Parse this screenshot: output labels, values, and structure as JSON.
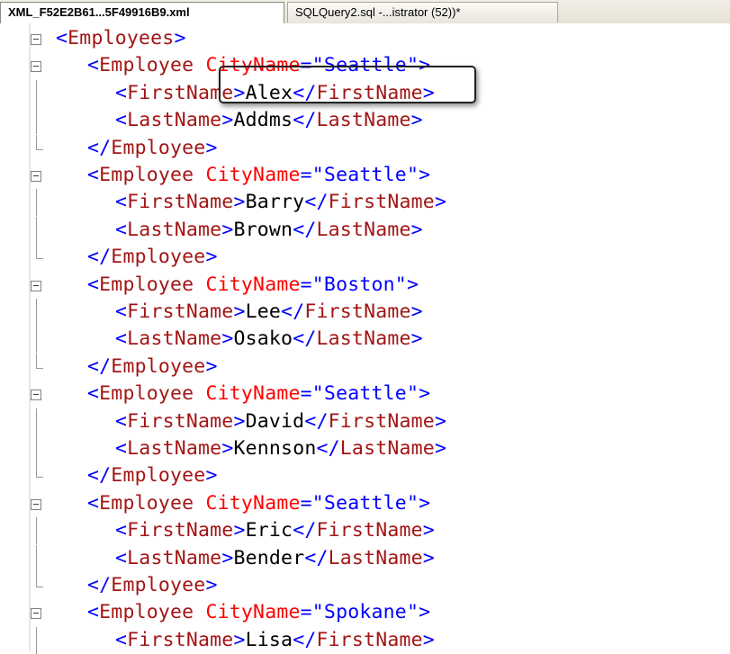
{
  "tabs": [
    {
      "label": "XML_F52E2B61...5F49916B9.xml",
      "active": true
    },
    {
      "label": "SQLQuery2.sql -...istrator (52))*",
      "active": false
    }
  ],
  "xml": {
    "root_tag": "Employees",
    "element_tag": "Employee",
    "attr_name": "CityName",
    "first_tag": "FirstName",
    "last_tag": "LastName",
    "employees": [
      {
        "city": "Seattle",
        "first": "Alex",
        "last": "Addms"
      },
      {
        "city": "Seattle",
        "first": "Barry",
        "last": "Brown"
      },
      {
        "city": "Boston",
        "first": "Lee",
        "last": "Osako"
      },
      {
        "city": "Seattle",
        "first": "David",
        "last": "Kennson"
      },
      {
        "city": "Seattle",
        "first": "Eric",
        "last": "Bender"
      },
      {
        "city": "Spokane",
        "first": "Lisa",
        "last": ""
      }
    ]
  },
  "colors": {
    "tag": "#a31515",
    "delim": "#0000ff",
    "attr": "#ff0000",
    "text": "#000000"
  }
}
